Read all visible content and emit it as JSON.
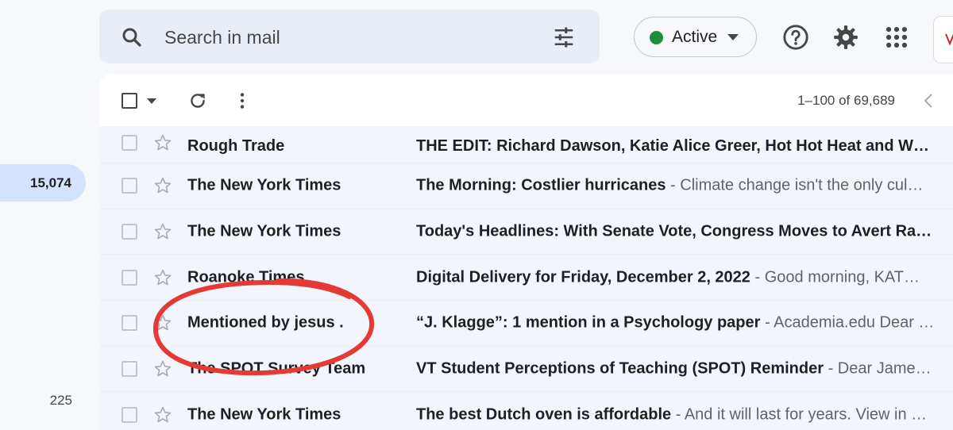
{
  "left_rail": {
    "highlighted_count": "15,074",
    "secondary_count": "225"
  },
  "search": {
    "placeholder": "Search in mail"
  },
  "status": {
    "label": "Active",
    "color": "#1e8e3e"
  },
  "icons": {
    "search": "search-icon",
    "filters": "tune-icon",
    "help": "help-icon",
    "settings": "gear-icon",
    "apps": "apps-grid-icon",
    "refresh": "refresh-icon",
    "more": "more-vert-icon",
    "star": "star-icon",
    "prev": "chevron-left-icon"
  },
  "pager": {
    "text": "1–100 of 69,689"
  },
  "emails": [
    {
      "sender": "Rough Trade",
      "subject": "THE EDIT: Richard Dawson, Katie Alice Greer, Hot Hot Heat and W…",
      "snippet": ""
    },
    {
      "sender": "The New York Times",
      "subject": "The Morning: Costlier hurricanes",
      "snippet": " - Climate change isn't the only cul…"
    },
    {
      "sender": "The New York Times",
      "subject": "Today's Headlines: With Senate Vote, Congress Moves to Avert Ra…",
      "snippet": ""
    },
    {
      "sender": "Roanoke Times",
      "subject": "Digital Delivery for Friday, December 2, 2022",
      "snippet": " - Good morning, KAT…"
    },
    {
      "sender": "Mentioned by jesus .",
      "subject": "“J. Klagge”: 1 mention in a Psychology paper",
      "snippet": " - Academia.edu Dear …"
    },
    {
      "sender": "The SPOT Survey Team",
      "subject": "VT Student Perceptions of Teaching (SPOT) Reminder",
      "snippet": " - Dear Jame…"
    },
    {
      "sender": "The New York Times",
      "subject": "The best Dutch oven is affordable",
      "snippet": " - And it will last for years. View in …"
    }
  ],
  "annotation": {
    "color": "#e53935",
    "target": "Mentioned by jesus ."
  }
}
